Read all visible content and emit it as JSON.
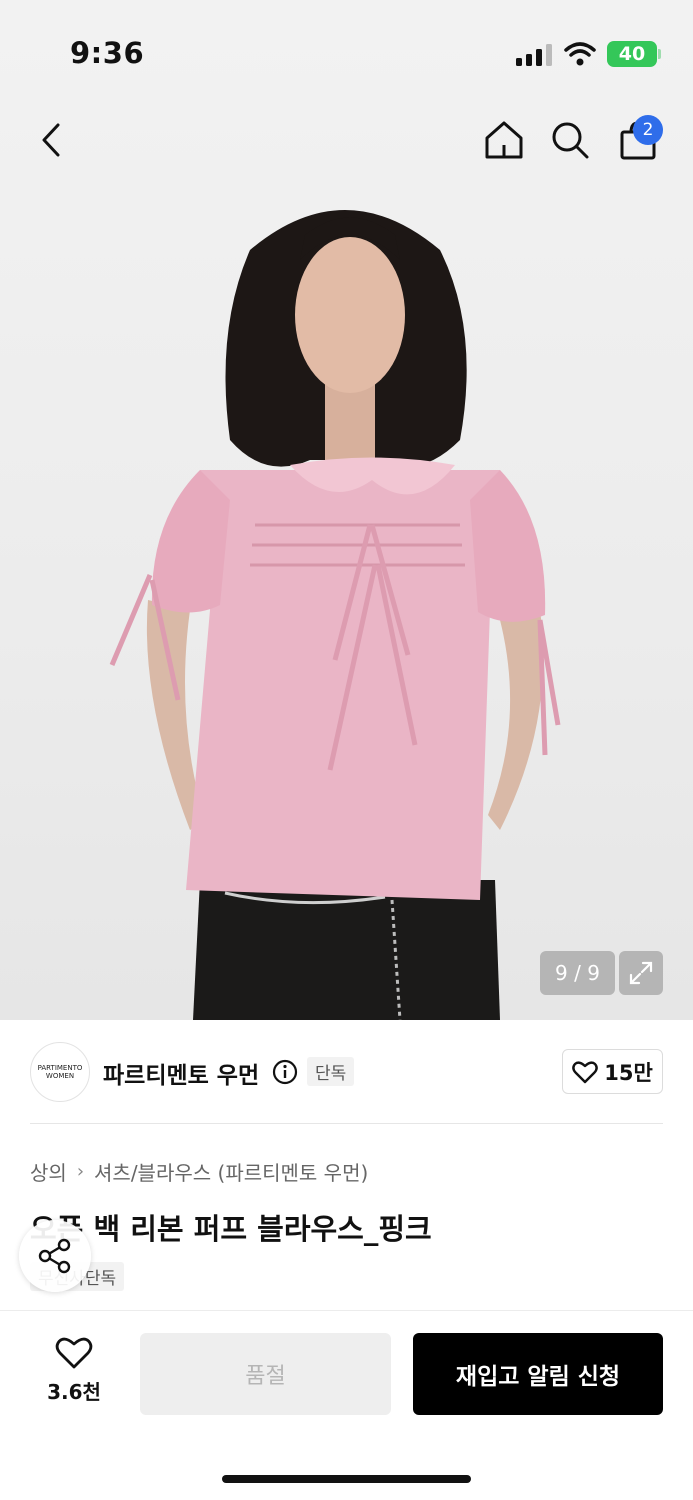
{
  "status_bar": {
    "time": "9:36",
    "battery": "40"
  },
  "nav": {
    "back_icon": "chevron-left-icon",
    "home_icon": "home-icon",
    "search_icon": "search-icon",
    "bag_icon": "shopping-bag-icon",
    "cart_count": "2"
  },
  "gallery": {
    "counter": "9 / 9",
    "expand_icon": "expand-icon"
  },
  "brand": {
    "logo_line1": "PARTIMENTO",
    "logo_line2": "WOMEN",
    "name": "파르티멘토 우먼",
    "exclusive_label": "단독",
    "like_count": "15만"
  },
  "product": {
    "breadcrumb": [
      "상의",
      "셔츠/블라우스 (파르티멘토 우먼)"
    ],
    "title": "오픈 백 리본 퍼프 블라우스_핑크",
    "tag": "무신사단독"
  },
  "bottom_bar": {
    "wish_count": "3.6천",
    "soldout_label": "품절",
    "restock_label": "재입고 알림 신청"
  },
  "colors": {
    "accent_blue": "#2f6dea",
    "battery_green": "#34c759",
    "blouse_pink": "#eab5c6"
  }
}
